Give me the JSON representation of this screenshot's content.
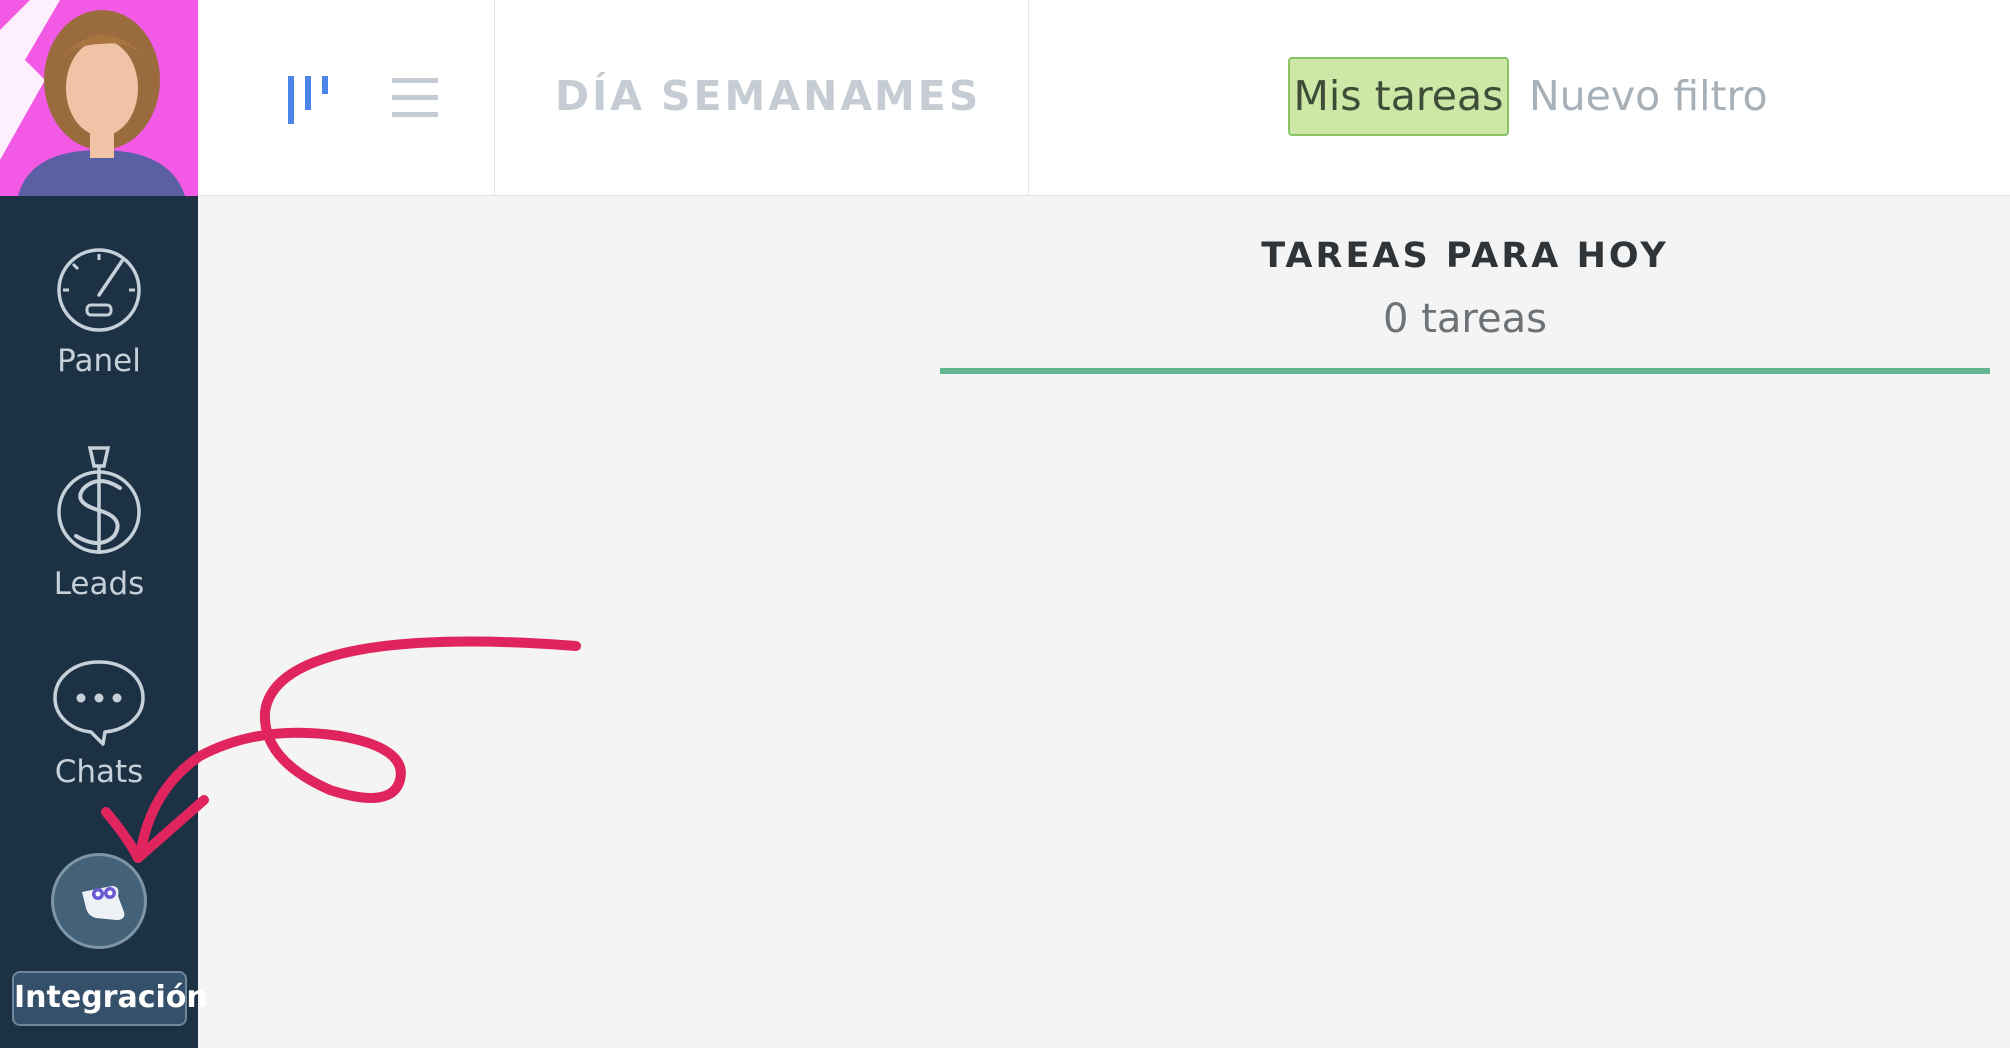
{
  "sidebar": {
    "items": [
      {
        "label": "Panel",
        "icon": "speedometer-icon"
      },
      {
        "label": "Leads",
        "icon": "dollar-icon"
      },
      {
        "label": "Chats",
        "icon": "chat-bubble-icon"
      }
    ],
    "integration": {
      "label": "Integración",
      "icon": "bot-icon"
    }
  },
  "topbar": {
    "view_icons": [
      "pipeline-view-icon",
      "list-view-icon"
    ],
    "periods": [
      "DÍA",
      "SEMANA",
      "MES"
    ],
    "filters": {
      "active": "Mis tareas",
      "new": "Nuevo filtro"
    }
  },
  "main": {
    "column_title": "TAREAS PARA HOY",
    "column_count": "0 tareas"
  },
  "colors": {
    "sidebar_bg": "#1c3144",
    "active_filter_bg": "#cde8a6",
    "column_accent": "#63b790",
    "annotation_arrow": "#e0245e",
    "avatar_bg": "#f259e4"
  }
}
